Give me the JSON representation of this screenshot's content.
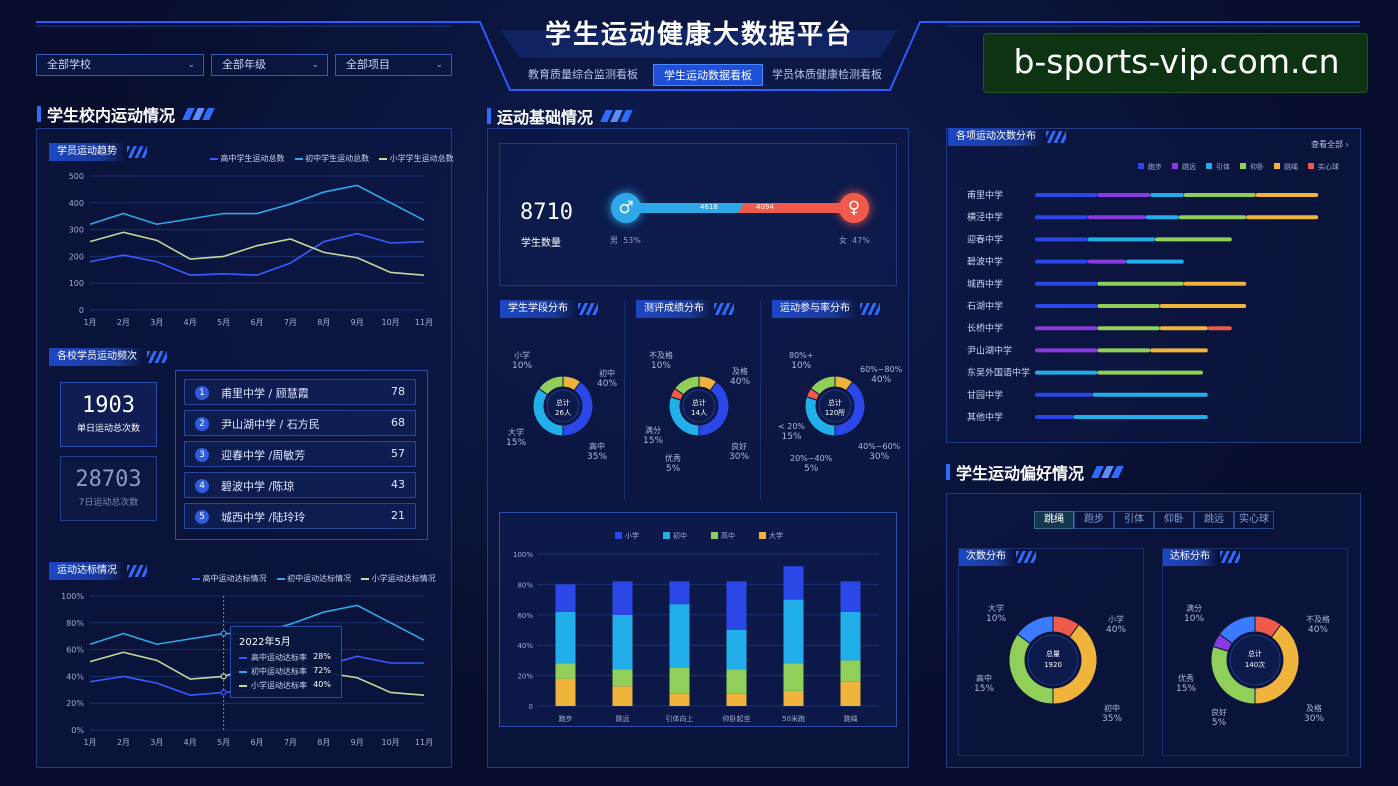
{
  "header": {
    "title": "学生运动健康大数据平台",
    "watermark": "b-sports-vip.com.cn"
  },
  "tabs": [
    "教育质量综合监测看板",
    "学生运动数据看板",
    "学员体质健康检测看板"
  ],
  "active_tab": 1,
  "filters": [
    "全部学校",
    "全部年级",
    "全部项目"
  ],
  "left": {
    "title": "学生校内运动情况",
    "trend": {
      "sub_title": "学员运动趋势",
      "legend": [
        "高中学生运动总数",
        "初中学生运动总数",
        "小学学生运动总数"
      ]
    },
    "freq": {
      "sub_title": "各校学员运动频次",
      "daily_value": "1903",
      "daily_label": "单日运动总次数",
      "weekly_value": "28703",
      "weekly_label": "7日运动总次数",
      "ranking": [
        {
          "no": "1",
          "name": "甫里中学 / 顾慧霞",
          "value": "78"
        },
        {
          "no": "2",
          "name": "尹山湖中学 / 石方民",
          "value": "68"
        },
        {
          "no": "3",
          "name": "迎春中学 /周敏芳",
          "value": "57"
        },
        {
          "no": "4",
          "name": "碧波中学 /陈琼",
          "value": "43"
        },
        {
          "no": "5",
          "name": "城西中学 /陆玲玲",
          "value": "21"
        }
      ]
    },
    "attain": {
      "sub_title": "运动达标情况",
      "legend": [
        "高中运动达标情况",
        "初中运动达标情况",
        "小学运动达标情况"
      ],
      "tooltip": {
        "title": "2022年5月",
        "rows": [
          {
            "label": "高中运动达标率",
            "value": "28%"
          },
          {
            "label": "初中运动达标率",
            "value": "72%"
          },
          {
            "label": "小学运动达标率",
            "value": "40%"
          }
        ]
      }
    }
  },
  "middle": {
    "title": "运动基础情况",
    "count_value": "8710",
    "count_label": "学生数量",
    "male_count": "4618",
    "female_count": "4094",
    "male_label": "男  53%",
    "female_label": "女  47%",
    "donuts": [
      {
        "sub_title": "学生学段分布",
        "center_top": "总计",
        "center_bottom": "26人",
        "labels": [
          {
            "name": "小学",
            "pct": "10%"
          },
          {
            "name": "初中",
            "pct": "40%"
          },
          {
            "name": "大学",
            "pct": "15%"
          },
          {
            "name": "高中",
            "pct": "35%"
          }
        ]
      },
      {
        "sub_title": "测评成绩分布",
        "center_top": "总计",
        "center_bottom": "14人",
        "labels": [
          {
            "name": "不及格",
            "pct": "10%"
          },
          {
            "name": "及格",
            "pct": "40%"
          },
          {
            "name": "满分",
            "pct": "15%"
          },
          {
            "name": "良好",
            "pct": "30%"
          },
          {
            "name": "优秀",
            "pct": "5%"
          }
        ]
      },
      {
        "sub_title": "运动参与率分布",
        "center_top": "总计",
        "center_bottom": "120所",
        "labels": [
          {
            "name": "80%+",
            "pct": "10%"
          },
          {
            "name": "60%~80%",
            "pct": "40%"
          },
          {
            "name": "< 20%",
            "pct": "15%"
          },
          {
            "name": "40%~60%",
            "pct": "30%"
          },
          {
            "name": "20%~40%",
            "pct": "5%"
          }
        ]
      }
    ]
  },
  "right": {
    "dist": {
      "sub_title": "各项运动次数分布",
      "view_all": "查看全部",
      "legend": [
        "跑步",
        "跳远",
        "引体",
        "仰卧",
        "跳绳",
        "实心球"
      ],
      "schools": [
        "甫里中学",
        "横泾中学",
        "迎春中学",
        "碧波中学",
        "城西中学",
        "石湖中学",
        "长桥中学",
        "尹山湖中学",
        "东吴外国语中学",
        "甘园中学",
        "其他中学"
      ]
    },
    "pref": {
      "title": "学生运动偏好情况",
      "tabs": [
        "跳绳",
        "跑步",
        "引体",
        "仰卧",
        "跳远",
        "实心球"
      ],
      "donuts": [
        {
          "sub_title": "次数分布",
          "center_top": "总量",
          "center_bottom": "1920",
          "labels": [
            {
              "name": "大学",
              "pct": "10%"
            },
            {
              "name": "小学",
              "pct": "40%"
            },
            {
              "name": "高中",
              "pct": "15%"
            },
            {
              "name": "初中",
              "pct": "35%"
            }
          ]
        },
        {
          "sub_title": "达标分布",
          "center_top": "总计",
          "center_bottom": "140次",
          "labels": [
            {
              "name": "满分",
              "pct": "10%"
            },
            {
              "name": "不及格",
              "pct": "40%"
            },
            {
              "name": "优秀",
              "pct": "15%"
            },
            {
              "name": "及格",
              "pct": "30%"
            },
            {
              "name": "良好",
              "pct": "5%"
            }
          ]
        }
      ]
    }
  },
  "chart_data": [
    {
      "type": "line",
      "title": "学员运动趋势",
      "categories": [
        "1月",
        "2月",
        "3月",
        "4月",
        "5月",
        "6月",
        "7月",
        "8月",
        "9月",
        "10月",
        "11月"
      ],
      "ylim": [
        0,
        500
      ],
      "yticks": [
        0,
        100,
        200,
        300,
        400,
        500
      ],
      "grid": true,
      "legend": "top-right",
      "series": [
        {
          "name": "高中学生运动总数",
          "color": "#3b5bff",
          "values": [
            180,
            205,
            180,
            130,
            135,
            130,
            175,
            255,
            285,
            250,
            255
          ]
        },
        {
          "name": "初中学生运动总数",
          "color": "#2ea8e8",
          "values": [
            320,
            360,
            320,
            340,
            360,
            360,
            395,
            440,
            465,
            400,
            335
          ]
        },
        {
          "name": "小学学生运动总数",
          "color": "#c8d89a",
          "values": [
            255,
            290,
            260,
            190,
            200,
            240,
            265,
            215,
            195,
            140,
            130
          ]
        }
      ]
    },
    {
      "type": "line",
      "title": "运动达标情况",
      "categories": [
        "1月",
        "2月",
        "3月",
        "4月",
        "5月",
        "6月",
        "7月",
        "8月",
        "9月",
        "10月",
        "11月"
      ],
      "ylim": [
        0,
        100
      ],
      "yticks": [
        "0%",
        "20%",
        "40%",
        "60%",
        "80%",
        "100%"
      ],
      "grid": true,
      "legend": "top-right",
      "series": [
        {
          "name": "高中运动达标情况",
          "color": "#3b5bff",
          "values": [
            36,
            40,
            35,
            26,
            28,
            30,
            35,
            48,
            55,
            50,
            50
          ]
        },
        {
          "name": "初中运动达标情况",
          "color": "#2ea8e8",
          "values": [
            64,
            72,
            64,
            68,
            72,
            72,
            79,
            88,
            93,
            80,
            67
          ]
        },
        {
          "name": "小学运动达标情况",
          "color": "#c8d89a",
          "values": [
            51,
            58,
            52,
            38,
            40,
            48,
            53,
            43,
            39,
            28,
            26
          ]
        }
      ]
    },
    {
      "type": "bar",
      "stacked": true,
      "categories": [
        "跑步",
        "跳远",
        "引体向上",
        "仰卧起坐",
        "50米跑",
        "跳绳"
      ],
      "ylim": [
        0,
        100
      ],
      "yticks": [
        "0",
        "20%",
        "40%",
        "60%",
        "80%",
        "100%"
      ],
      "legend": "top",
      "series": [
        {
          "name": "小学",
          "color": "#2b47e8",
          "values": [
            18,
            22,
            15,
            32,
            22,
            20
          ]
        },
        {
          "name": "初中",
          "color": "#22aee8",
          "values": [
            34,
            36,
            42,
            26,
            42,
            32
          ]
        },
        {
          "name": "高中",
          "color": "#8fcf5a",
          "values": [
            10,
            11,
            17,
            16,
            18,
            14
          ]
        },
        {
          "name": "大学",
          "color": "#f0b43c",
          "values": [
            18,
            13,
            8,
            8,
            10,
            16
          ]
        }
      ]
    },
    {
      "type": "bar",
      "orientation": "horizontal",
      "title": "各项运动次数分布",
      "categories": [
        "甫里中学",
        "横泾中学",
        "迎春中学",
        "碧波中学",
        "城西中学",
        "石湖中学",
        "长桥中学",
        "尹山湖中学",
        "东吴外国语中学",
        "甘园中学",
        "其他中学"
      ],
      "series": [
        {
          "name": "跑步",
          "color": "#2b47e8",
          "values": [
            65,
            55,
            55,
            55,
            65,
            65,
            0,
            0,
            0,
            60,
            40
          ]
        },
        {
          "name": "跳远",
          "color": "#8a3be0",
          "values": [
            55,
            60,
            0,
            40,
            0,
            0,
            65,
            65,
            0,
            0,
            0
          ]
        },
        {
          "name": "引体",
          "color": "#22aee8",
          "values": [
            35,
            35,
            70,
            60,
            0,
            0,
            0,
            0,
            65,
            120,
            140
          ]
        },
        {
          "name": "仰卧",
          "color": "#8fcf5a",
          "values": [
            75,
            70,
            80,
            0,
            90,
            65,
            65,
            55,
            110,
            0,
            0
          ]
        },
        {
          "name": "跳绳",
          "color": "#f0b43c",
          "values": [
            65,
            75,
            0,
            0,
            65,
            90,
            50,
            60,
            0,
            0,
            0
          ]
        },
        {
          "name": "实心球",
          "color": "#f05a4a",
          "values": [
            0,
            0,
            0,
            0,
            0,
            0,
            25,
            0,
            0,
            0,
            0
          ]
        }
      ]
    },
    {
      "type": "pie",
      "title": "学生学段分布",
      "labels": [
        "小学",
        "初中",
        "高中",
        "大学"
      ],
      "values": [
        10,
        40,
        35,
        15
      ]
    },
    {
      "type": "pie",
      "title": "测评成绩分布",
      "labels": [
        "不及格",
        "及格",
        "良好",
        "优秀",
        "满分"
      ],
      "values": [
        10,
        40,
        30,
        5,
        15
      ]
    },
    {
      "type": "pie",
      "title": "运动参与率分布",
      "labels": [
        "80%+",
        "60%~80%",
        "40%~60%",
        "20%~40%",
        "< 20%"
      ],
      "values": [
        10,
        40,
        30,
        5,
        15
      ]
    },
    {
      "type": "pie",
      "title": "次数分布",
      "labels": [
        "大学",
        "小学",
        "初中",
        "高中"
      ],
      "values": [
        10,
        40,
        35,
        15
      ]
    },
    {
      "type": "pie",
      "title": "达标分布",
      "labels": [
        "满分",
        "不及格",
        "及格",
        "良好",
        "优秀"
      ],
      "values": [
        10,
        40,
        30,
        5,
        15
      ]
    }
  ]
}
